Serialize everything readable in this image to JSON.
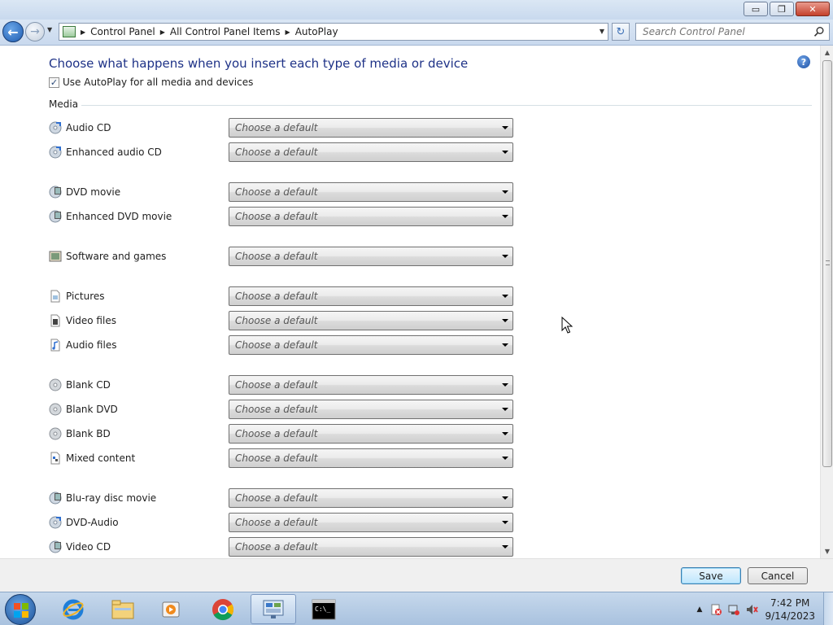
{
  "window": {
    "minimize_glyph": "▭",
    "restore_glyph": "❐",
    "close_glyph": "✕"
  },
  "nav": {
    "breadcrumbs": [
      "Control Panel",
      "All Control Panel Items",
      "AutoPlay"
    ],
    "search_placeholder": "Search Control Panel"
  },
  "page": {
    "title": "Choose what happens when you insert each type of media or device",
    "use_autoplay_label": "Use AutoPlay for all media and devices",
    "use_autoplay_checked": true,
    "group_label": "Media"
  },
  "media_rows": [
    {
      "label": "Audio CD",
      "value": "Choose a default",
      "icon": "audio-cd-icon"
    },
    {
      "label": "Enhanced audio CD",
      "value": "Choose a default",
      "icon": "enhanced-audio-cd-icon"
    },
    {
      "label": "DVD movie",
      "value": "Choose a default",
      "icon": "dvd-movie-icon"
    },
    {
      "label": "Enhanced DVD movie",
      "value": "Choose a default",
      "icon": "enhanced-dvd-movie-icon"
    },
    {
      "label": "Software and games",
      "value": "Choose a default",
      "icon": "software-games-icon"
    },
    {
      "label": "Pictures",
      "value": "Choose a default",
      "icon": "pictures-icon"
    },
    {
      "label": "Video files",
      "value": "Choose a default",
      "icon": "video-files-icon"
    },
    {
      "label": "Audio files",
      "value": "Choose a default",
      "icon": "audio-files-icon"
    },
    {
      "label": "Blank CD",
      "value": "Choose a default",
      "icon": "blank-cd-icon"
    },
    {
      "label": "Blank DVD",
      "value": "Choose a default",
      "icon": "blank-dvd-icon"
    },
    {
      "label": "Blank BD",
      "value": "Choose a default",
      "icon": "blank-bd-icon"
    },
    {
      "label": "Mixed content",
      "value": "Choose a default",
      "icon": "mixed-content-icon"
    },
    {
      "label": "Blu-ray disc movie",
      "value": "Choose a default",
      "icon": "bluray-movie-icon"
    },
    {
      "label": "DVD-Audio",
      "value": "Choose a default",
      "icon": "dvd-audio-icon"
    },
    {
      "label": "Video CD",
      "value": "Choose a default",
      "icon": "video-cd-icon"
    }
  ],
  "footer": {
    "save_label": "Save",
    "cancel_label": "Cancel"
  },
  "taskbar": {
    "items": [
      "internet-explorer-icon",
      "file-explorer-icon",
      "media-player-icon",
      "chrome-icon",
      "control-panel-icon",
      "command-prompt-icon"
    ],
    "active_item": "control-panel-icon",
    "time": "7:42 PM",
    "date": "9/14/2023"
  }
}
